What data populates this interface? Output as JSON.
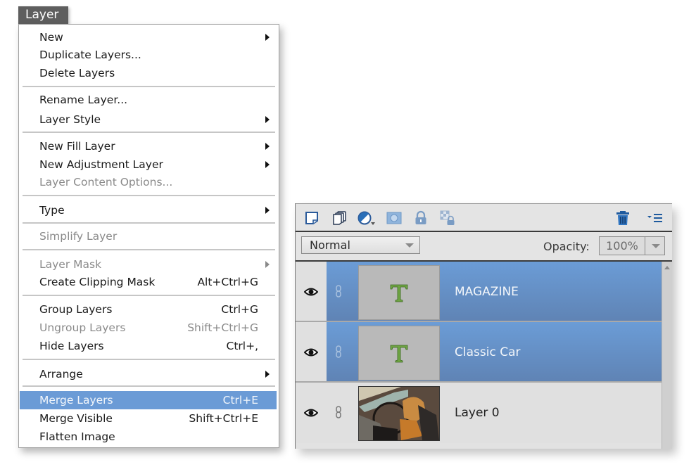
{
  "menu": {
    "title": "Layer",
    "items": [
      {
        "label": "New",
        "shortcut": "",
        "submenu": true,
        "enabled": true
      },
      {
        "label": "Duplicate Layers...",
        "shortcut": "",
        "submenu": false,
        "enabled": true
      },
      {
        "label": "Delete Layers",
        "shortcut": "",
        "submenu": false,
        "enabled": true
      },
      {
        "label": "Rename Layer...",
        "shortcut": "",
        "submenu": false,
        "enabled": true
      },
      {
        "label": "Layer Style",
        "shortcut": "",
        "submenu": true,
        "enabled": true
      },
      {
        "label": "New Fill Layer",
        "shortcut": "",
        "submenu": true,
        "enabled": true
      },
      {
        "label": "New Adjustment Layer",
        "shortcut": "",
        "submenu": true,
        "enabled": true
      },
      {
        "label": "Layer Content Options...",
        "shortcut": "",
        "submenu": false,
        "enabled": false
      },
      {
        "label": "Type",
        "shortcut": "",
        "submenu": true,
        "enabled": true
      },
      {
        "label": "Simplify Layer",
        "shortcut": "",
        "submenu": false,
        "enabled": false
      },
      {
        "label": "Layer Mask",
        "shortcut": "",
        "submenu": true,
        "enabled": false
      },
      {
        "label": "Create Clipping Mask",
        "shortcut": "Alt+Ctrl+G",
        "submenu": false,
        "enabled": true
      },
      {
        "label": "Group Layers",
        "shortcut": "Ctrl+G",
        "submenu": false,
        "enabled": true
      },
      {
        "label": "Ungroup Layers",
        "shortcut": "Shift+Ctrl+G",
        "submenu": false,
        "enabled": false
      },
      {
        "label": "Hide Layers",
        "shortcut": "Ctrl+,",
        "submenu": false,
        "enabled": true
      },
      {
        "label": "Arrange",
        "shortcut": "",
        "submenu": true,
        "enabled": true
      },
      {
        "label": "Merge Layers",
        "shortcut": "Ctrl+E",
        "submenu": false,
        "enabled": true,
        "highlighted": true
      },
      {
        "label": "Merge Visible",
        "shortcut": "Shift+Ctrl+E",
        "submenu": false,
        "enabled": true
      },
      {
        "label": "Flatten Image",
        "shortcut": "",
        "submenu": false,
        "enabled": true
      }
    ]
  },
  "panel": {
    "toolbar": {
      "icons": [
        "new-layer-icon",
        "new-group-icon",
        "adjustment-layer-icon",
        "add-mask-icon",
        "lock-all-icon",
        "lock-transparent-icon",
        "delete-layer-icon",
        "panel-menu-icon"
      ]
    },
    "blend_mode": "Normal",
    "opacity_label": "Opacity:",
    "opacity_value": "100%",
    "layers": [
      {
        "name": "MAGAZINE",
        "type": "text",
        "selected": true,
        "visible": true
      },
      {
        "name": "Classic Car",
        "type": "text",
        "selected": true,
        "visible": true
      },
      {
        "name": "Layer 0",
        "type": "image",
        "selected": false,
        "visible": true
      }
    ],
    "colors": {
      "selection": "#6b9bd6",
      "text_layer_icon": "#6fa544"
    }
  }
}
